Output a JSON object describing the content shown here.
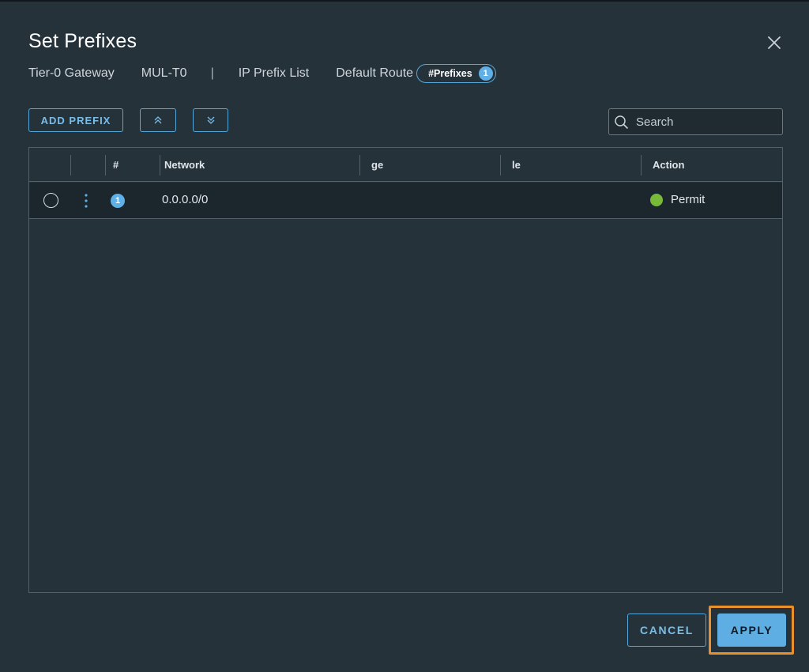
{
  "dialog": {
    "title": "Set Prefixes"
  },
  "breadcrumb": {
    "gateway_label": "Tier-0 Gateway",
    "gateway_name": "MUL-T0",
    "separator": "|",
    "list_label": "IP Prefix List",
    "list_name": "Default Route",
    "prefix_badge_label": "#Prefixes",
    "prefix_badge_count": "1"
  },
  "toolbar": {
    "add_prefix_label": "ADD PREFIX",
    "move_up_icon": "double-chevron-up-icon",
    "move_down_icon": "double-chevron-down-icon",
    "search_placeholder": "Search"
  },
  "table": {
    "columns": [
      "#",
      "Network",
      "ge",
      "le",
      "Action"
    ],
    "rows": [
      {
        "number": "1",
        "network": "0.0.0.0/0",
        "ge": "",
        "le": "",
        "action": "Permit",
        "action_color": "#79b93a",
        "selected": false
      }
    ]
  },
  "footer": {
    "cancel_label": "CANCEL",
    "apply_label": "APPLY",
    "apply_highlight_color": "#e98f2c"
  },
  "colors": {
    "background": "#25323a",
    "accent": "#5eaee3"
  }
}
